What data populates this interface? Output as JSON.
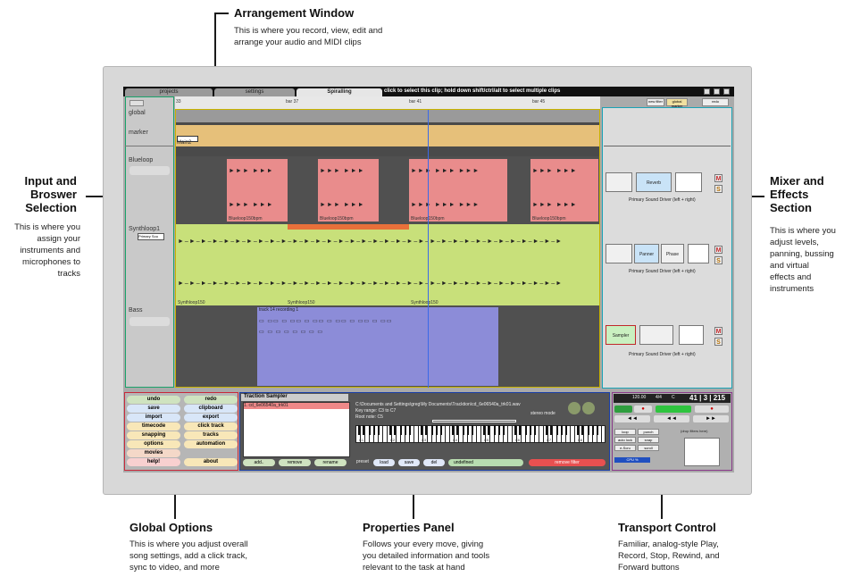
{
  "annotations": {
    "arrangement": {
      "title": "Arrangement Window",
      "text": [
        "This is where you record, view, edit and",
        "arrange your audio and MIDI clips"
      ]
    },
    "input": {
      "title": [
        "Input and",
        "Broswer",
        "Selection"
      ],
      "text": [
        "This is where you",
        "assign your",
        "instruments and",
        "microphones to",
        "tracks"
      ]
    },
    "mixer": {
      "title": [
        "Mixer and",
        "Effects",
        "Section"
      ],
      "text": [
        "This is where you",
        "adjust levels,",
        "panning, bussing",
        "and virtual",
        "effects and",
        "instruments"
      ]
    },
    "global": {
      "title": "Global Options",
      "text": [
        "This is where you adjust overall",
        "song settings, add a click track,",
        "sync to video, and more"
      ]
    },
    "properties": {
      "title": "Properties Panel",
      "text": [
        "Follows your every move, giving",
        "you detailed information and tools",
        "relevant to the task at hand"
      ]
    },
    "transport": {
      "title": "Transport Control",
      "text": [
        "Familiar, analog-style Play,",
        "Record, Stop, Rewind, and",
        "Forward buttons"
      ]
    }
  },
  "app": {
    "tabs": [
      "projects",
      "settings",
      "Spiralling"
    ],
    "hint": "click to select this clip; hold down shift/ctrl/alt to select multiple clips",
    "ruler_ticks": [
      "33",
      "bar 37",
      "bar 41",
      "bar 45"
    ],
    "tracks": [
      "global",
      "marker",
      "Blueloop",
      "Synthloop1",
      "Bass"
    ],
    "marker_label": "Main2",
    "synth_mini": "Primary Sou",
    "clip_labels": {
      "blue": "Blueloop150bpm",
      "synth": "Synthloop150",
      "bass": "track 14 recording 1"
    },
    "top_right_buttons": [
      "new filter",
      "global marker",
      "redo"
    ],
    "mixer": {
      "driver": "Primary Sound Driver (left + right)",
      "plugins": [
        "Reverb",
        "Panner",
        "Phase",
        "Sampler"
      ],
      "m": "M",
      "s": "S"
    },
    "global_buttons": [
      [
        "undo",
        "redo"
      ],
      [
        "save",
        "clipboard"
      ],
      [
        "import",
        "export"
      ],
      [
        "timecode",
        "click track"
      ],
      [
        "snapping",
        "tracks"
      ],
      [
        "options",
        "automation"
      ],
      [
        "movies",
        ""
      ],
      [
        "help!",
        "about"
      ]
    ],
    "properties": {
      "title": "Traction Sampler",
      "list_item": "1. cd_6e06540a_trk01",
      "path": "C:\\Documents and Settings\\greg\\My Documents\\Tracktion\\cd_6e06540a_trk01.wav",
      "key_range": "Key range: C3 to C7",
      "root_note": "Root note: C5",
      "openmode": "stereo mode",
      "keys_labels": [
        "C1",
        "C2",
        "C3",
        "C4",
        "C5",
        "C6",
        "C7",
        "C8"
      ],
      "buttons": [
        "add..",
        "remove",
        "rename"
      ],
      "preset_label": "preset",
      "preset_buttons": [
        "load",
        "save",
        "del"
      ],
      "preset_name": "undefined",
      "remove_filter": "remove filter"
    },
    "transport": {
      "time": "41 | 3 | 215",
      "tempo": "120.00",
      "sig": "4/4",
      "key": "C",
      "buttons": [
        "loop",
        "punch",
        "auto lock",
        "snap",
        "e-Scru",
        "scroll"
      ],
      "cpu": "CPU %",
      "drop": "(drop filters here)"
    }
  }
}
